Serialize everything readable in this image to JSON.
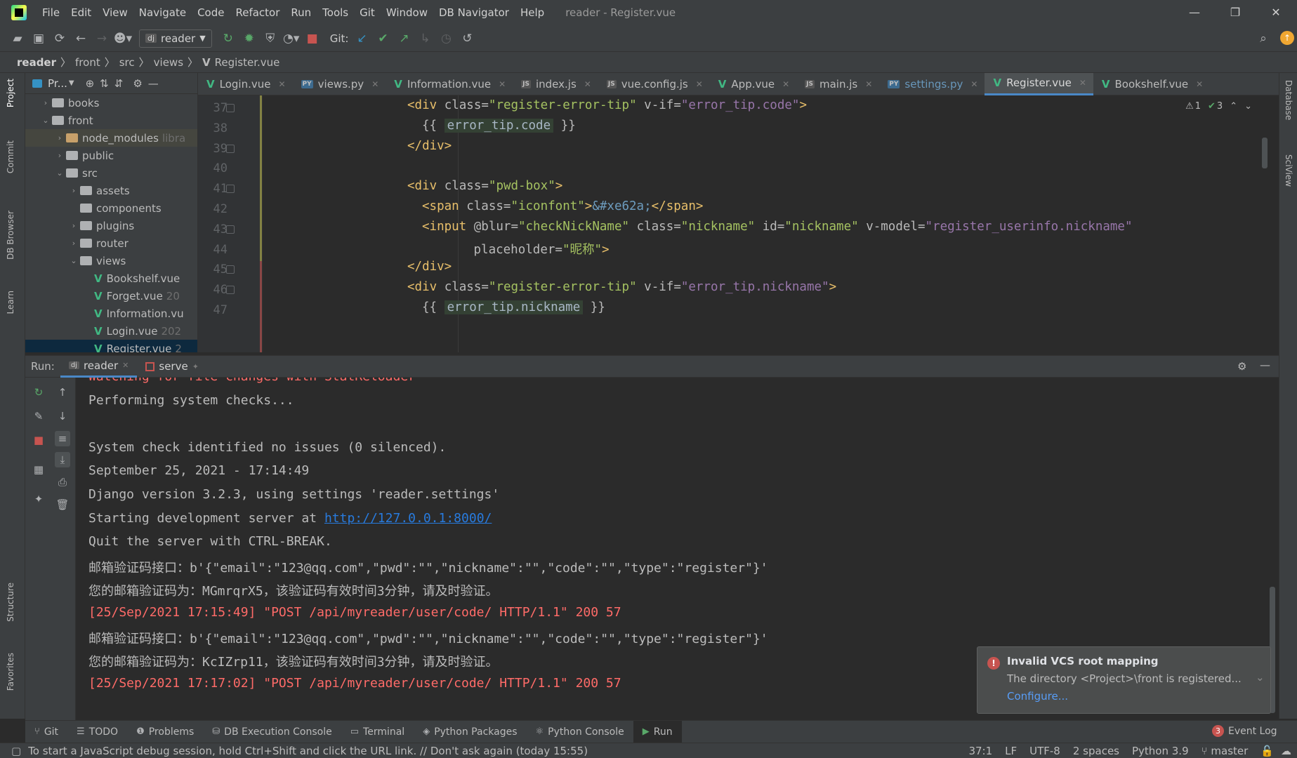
{
  "window": {
    "title": "reader - Register.vue",
    "menu": [
      "File",
      "Edit",
      "View",
      "Navigate",
      "Code",
      "Refactor",
      "Run",
      "Tools",
      "Git",
      "Window",
      "DB Navigator",
      "Help"
    ]
  },
  "toolbar": {
    "run_config": "reader",
    "git_label": "Git:"
  },
  "breadcrumb": [
    "reader",
    "front",
    "src",
    "views",
    "Register.vue"
  ],
  "left_strip": [
    "Project",
    "Commit",
    "DB Browser",
    "Learn",
    "Structure",
    "Favorites"
  ],
  "right_strip": [
    "Database",
    "SciView"
  ],
  "project": {
    "header": "Pr...",
    "tree": [
      {
        "label": "books",
        "type": "folder",
        "depth": 1,
        "arrow": "▶"
      },
      {
        "label": "front",
        "type": "folder",
        "depth": 1,
        "arrow": "▼"
      },
      {
        "label": "node_modules",
        "type": "folder-excluded",
        "depth": 2,
        "arrow": "▶",
        "extra": "libra"
      },
      {
        "label": "public",
        "type": "folder",
        "depth": 2,
        "arrow": "▶"
      },
      {
        "label": "src",
        "type": "folder",
        "depth": 2,
        "arrow": "▼"
      },
      {
        "label": "assets",
        "type": "folder",
        "depth": 3,
        "arrow": "▶"
      },
      {
        "label": "components",
        "type": "folder",
        "depth": 3,
        "arrow": ""
      },
      {
        "label": "plugins",
        "type": "folder",
        "depth": 3,
        "arrow": "▶"
      },
      {
        "label": "router",
        "type": "folder",
        "depth": 3,
        "arrow": "▶"
      },
      {
        "label": "views",
        "type": "folder",
        "depth": 3,
        "arrow": "▼"
      },
      {
        "label": "Bookshelf.vue",
        "type": "vue",
        "depth": 4,
        "arrow": ""
      },
      {
        "label": "Forget.vue",
        "type": "vue",
        "depth": 4,
        "arrow": "",
        "extra": "20"
      },
      {
        "label": "Information.vu",
        "type": "vue",
        "depth": 4,
        "arrow": ""
      },
      {
        "label": "Login.vue",
        "type": "vue",
        "depth": 4,
        "arrow": "",
        "extra": "202"
      },
      {
        "label": "Register.vue",
        "type": "vue",
        "depth": 4,
        "arrow": "",
        "extra": "2"
      }
    ]
  },
  "editor_tabs": [
    {
      "label": "Login.vue",
      "icon": "vue"
    },
    {
      "label": "views.py",
      "icon": "py"
    },
    {
      "label": "Information.vue",
      "icon": "vue"
    },
    {
      "label": "index.js",
      "icon": "js"
    },
    {
      "label": "vue.config.js",
      "icon": "js"
    },
    {
      "label": "App.vue",
      "icon": "vue"
    },
    {
      "label": "main.js",
      "icon": "js"
    },
    {
      "label": "settings.py",
      "icon": "py",
      "modified": true
    },
    {
      "label": "Register.vue",
      "icon": "vue",
      "active": true
    },
    {
      "label": "Bookshelf.vue",
      "icon": "vue"
    }
  ],
  "editor": {
    "inspections": {
      "warnings": "1",
      "weak": "3"
    },
    "line_numbers": [
      "37",
      "38",
      "39",
      "40",
      "41",
      "42",
      "43",
      "44",
      "45",
      "46",
      "47"
    ]
  },
  "run": {
    "label": "Run:",
    "tabs": [
      {
        "label": "reader",
        "active": true
      },
      {
        "label": "serve"
      }
    ],
    "console": [
      {
        "text": "Watching for file changes with StatReloader",
        "kind": "err"
      },
      {
        "text": "Performing system checks...",
        "kind": "out"
      },
      {
        "text": "",
        "kind": "out"
      },
      {
        "text": "System check identified no issues (0 silenced).",
        "kind": "out"
      },
      {
        "text": "September 25, 2021 - 17:14:49",
        "kind": "out"
      },
      {
        "text": "Django version 3.2.3, using settings 'reader.settings'",
        "kind": "out"
      },
      {
        "text": "Starting development server at ",
        "kind": "out",
        "link": "http://127.0.0.1:8000/"
      },
      {
        "text": "Quit the server with CTRL-BREAK.",
        "kind": "out"
      },
      {
        "text": "邮箱验证码接口：b'{\"email\":\"123@qq.com\",\"pwd\":\"\",\"nickname\":\"\",\"code\":\"\",\"type\":\"register\"}'",
        "kind": "out"
      },
      {
        "text": "您的邮箱验证码为：MGmrqrX5，该验证码有效时间3分钟，请及时验证。",
        "kind": "out"
      },
      {
        "text": "[25/Sep/2021 17:15:49] \"POST /api/myreader/user/code/ HTTP/1.1\" 200 57",
        "kind": "err"
      },
      {
        "text": "邮箱验证码接口：b'{\"email\":\"123@qq.com\",\"pwd\":\"\",\"nickname\":\"\",\"code\":\"\",\"type\":\"register\"}'",
        "kind": "out"
      },
      {
        "text": "您的邮箱验证码为：KcIZrp11，该验证码有效时间3分钟，请及时验证。",
        "kind": "out"
      },
      {
        "text": "[25/Sep/2021 17:17:02] \"POST /api/myreader/user/code/ HTTP/1.1\" 200 57",
        "kind": "err"
      }
    ]
  },
  "notification": {
    "title": "Invalid VCS root mapping",
    "body": "The directory <Project>\\front is registered...",
    "action": "Configure..."
  },
  "bottom_tools": [
    {
      "label": "Git",
      "icon": "git-icon"
    },
    {
      "label": "TODO",
      "icon": "todo-icon"
    },
    {
      "label": "Problems",
      "icon": "problems-icon"
    },
    {
      "label": "DB Execution Console",
      "icon": "db-console-icon"
    },
    {
      "label": "Terminal",
      "icon": "terminal-icon"
    },
    {
      "label": "Python Packages",
      "icon": "packages-icon"
    },
    {
      "label": "Python Console",
      "icon": "python-console-icon"
    },
    {
      "label": "Run",
      "icon": "run-icon",
      "active": true
    }
  ],
  "event_log": {
    "label": "Event Log",
    "count": "3"
  },
  "status": {
    "message": "To start a JavaScript debug session, hold Ctrl+Shift and click the URL link. // Don't ask again (today 15:55)",
    "position": "37:1",
    "line_sep": "LF",
    "encoding": "UTF-8",
    "indent": "2 spaces",
    "interpreter": "Python 3.9",
    "branch": "master"
  },
  "colors": {
    "accent": "#4a88c7",
    "vue_green": "#41b883",
    "error_red": "#ff6b68",
    "link_blue": "#287bde",
    "bg_panel": "#3c3f41",
    "bg_editor": "#2b2b2b"
  }
}
